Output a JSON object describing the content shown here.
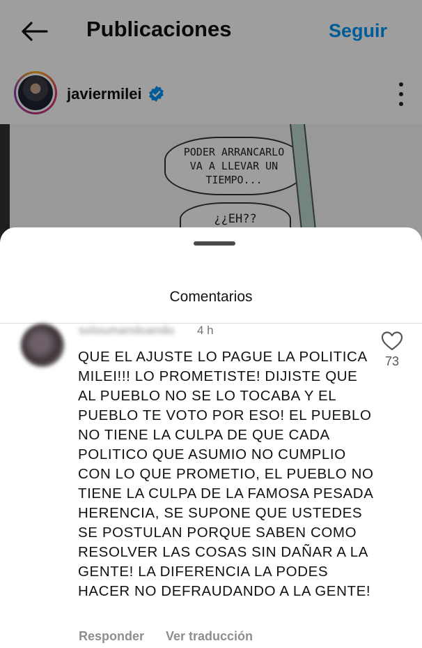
{
  "header": {
    "title": "Publicaciones",
    "follow_label": "Seguir",
    "back_icon": "arrow-left-icon"
  },
  "post": {
    "author": "javiermilei",
    "verified_icon": "verified-badge-icon",
    "more_icon": "more-vertical-icon",
    "comic_text_1_line1": "PODER ARRANCARLO",
    "comic_text_1_line2": "VA A LLEVAR UN",
    "comic_text_1_line3": "TIEMPO...",
    "comic_text_2": "¿¿EH??"
  },
  "comments_sheet": {
    "title": "Comentarios",
    "comments": [
      {
        "user": "soloumandoando",
        "time": "4 h",
        "text": "QUE EL AJUSTE LO PAGUE LA POLITICA MILEI!!! LO PROMETISTE! DIJISTE QUE AL PUEBLO NO SE LO TOCABA Y EL PUEBLO TE VOTO POR ESO! EL PUEBLO NO TIENE LA CULPA DE QUE CADA POLITICO QUE ASUMIO NO CUMPLIO CON LO QUE PROMETIO, EL PUEBLO NO TIENE LA CULPA DE LA FAMOSA PESADA HERENCIA, SE SUPONE QUE USTEDES SE POSTULAN PORQUE SABEN COMO RESOLVER LAS COSAS SIN DAÑAR A LA GENTE! LA DIFERENCIA LA PODES HACER NO DEFRAUDANDO A LA GENTE!",
        "likes": "73",
        "like_icon": "heart-outline-icon",
        "reply_label": "Responder",
        "translate_label": "Ver traducción"
      }
    ]
  },
  "colors": {
    "accent": "#0095f6",
    "muted": "#8e8e8e"
  }
}
